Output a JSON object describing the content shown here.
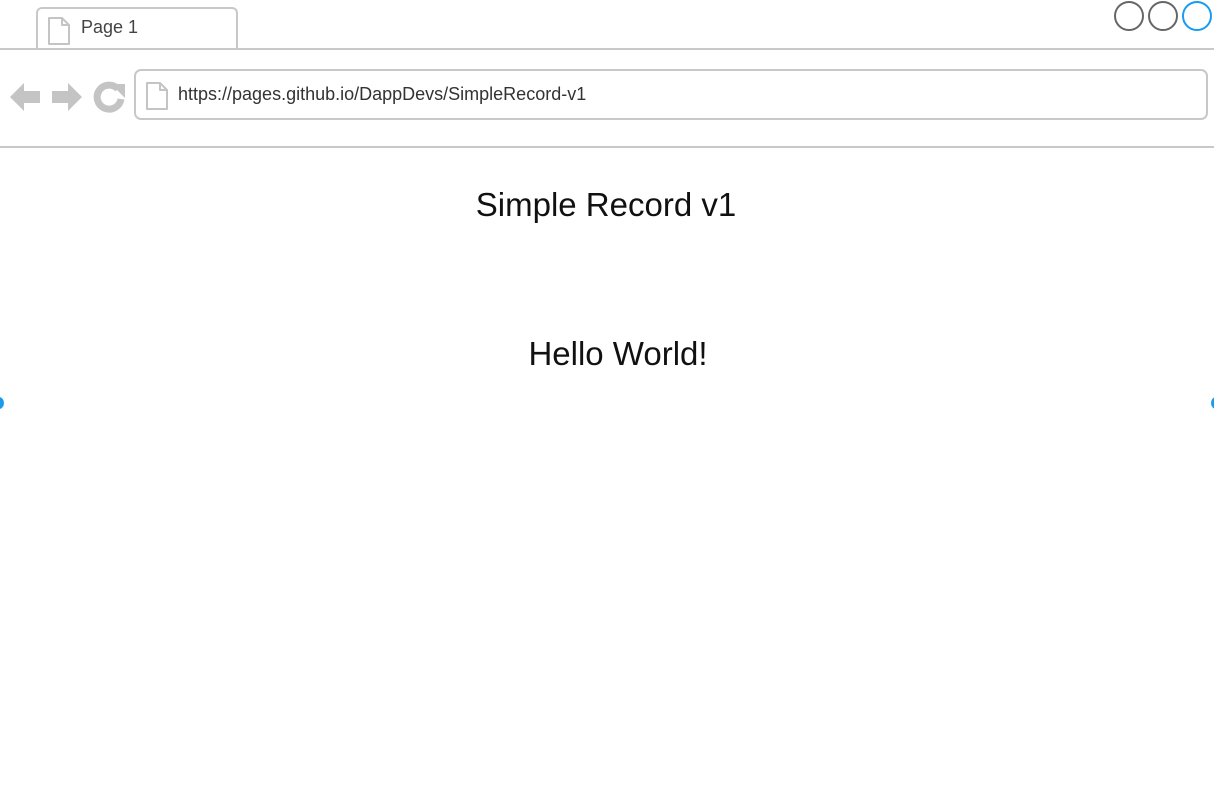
{
  "browser": {
    "tab": {
      "label": "Page 1",
      "icon": "page-icon"
    },
    "window_controls": [
      "circle",
      "circle",
      "circle"
    ],
    "nav": {
      "back_icon": "arrow-left-icon",
      "forward_icon": "arrow-right-icon",
      "reload_icon": "reload-icon"
    },
    "address_bar": {
      "url": "https://pages.github.io/DappDevs/SimpleRecord-v1",
      "icon": "page-icon"
    }
  },
  "page": {
    "title": "Simple Record v1",
    "message": "Hello World!"
  },
  "colors": {
    "chrome_gray": "#c8c8c8",
    "icon_gray": "#c4c4c4",
    "accent_blue": "#1a9bf0",
    "text": "#111111"
  }
}
